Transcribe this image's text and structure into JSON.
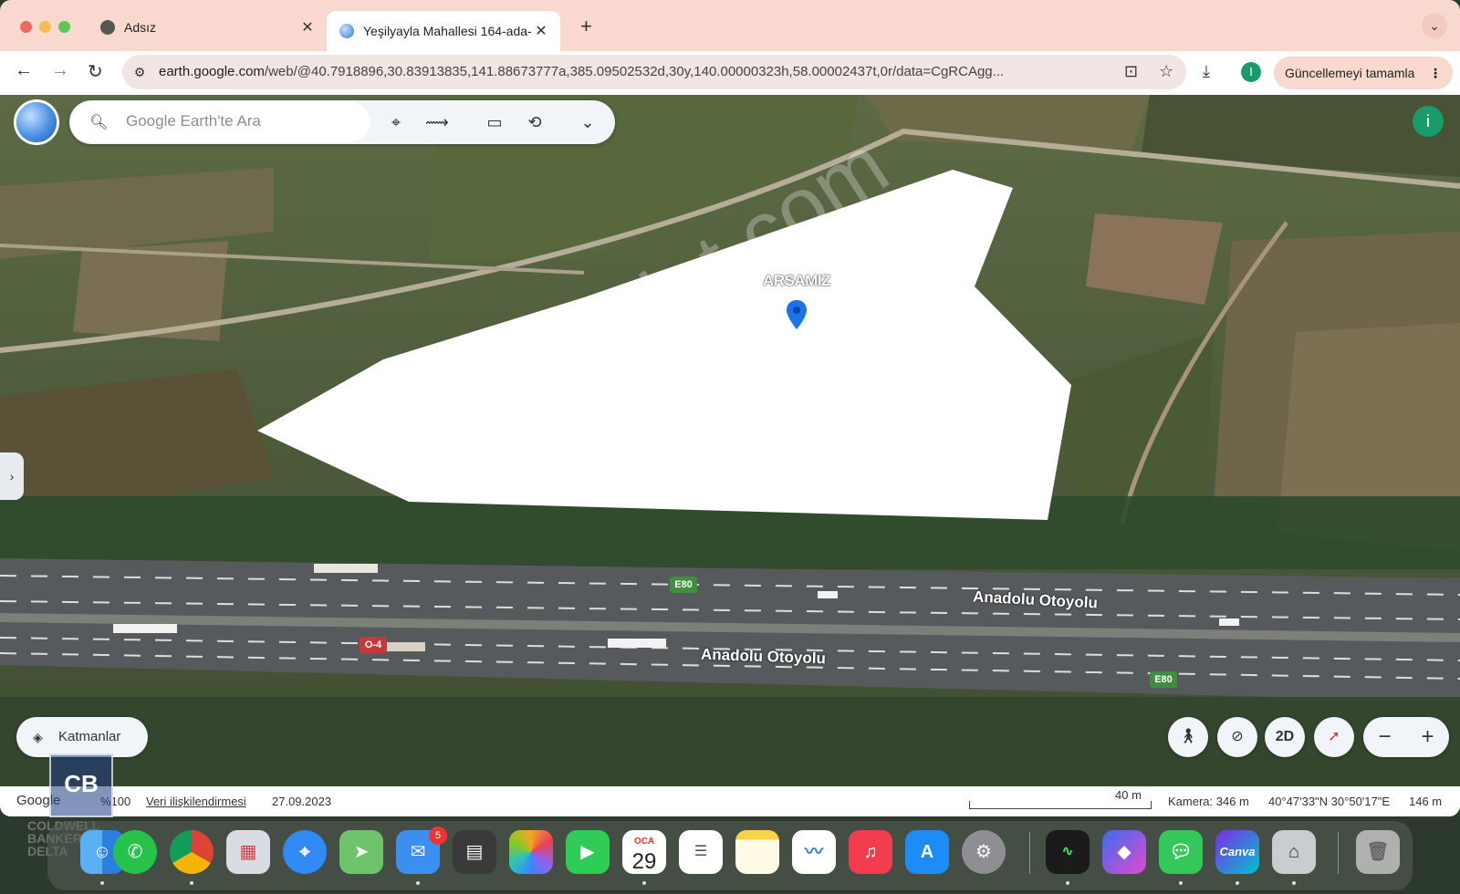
{
  "browser": {
    "tabs": [
      {
        "title": "Adsız"
      },
      {
        "title": "Yeşilyayla Mahallesi 164-ada-"
      }
    ],
    "url_host": "earth.google.com",
    "url_path": "/web/@40.7918896,30.83913835,141.88673777a,385.09502532d,30y,140.00000323h,58.00002437t,0r/data=CgRCAgg...",
    "update_label": "Güncellemeyi tamamla",
    "profile_initial": "I"
  },
  "earth": {
    "search_placeholder": "Google Earth'te Ara",
    "user_initial": "i",
    "parcel_label": "ARSAMIZ",
    "road_labels": [
      "Anadolu Otoyolu",
      "Anadolu Otoyolu"
    ],
    "shields": [
      {
        "text": "E80",
        "color": "#3f8f3f"
      },
      {
        "text": "E80",
        "color": "#3f8f3f"
      },
      {
        "text": "O-4",
        "color": "#c43a3a"
      }
    ],
    "watermark": "emlakjet.com",
    "layers_label": "Katmanlar",
    "ctrl_2d": "2D"
  },
  "status": {
    "google": "Google",
    "zoom": "%100",
    "data_link": "Veri ilişkilendirmesi",
    "date": "27.09.2023",
    "scale": "40 m",
    "camera": "Kamera: 346 m",
    "coords": "40°47'33\"N 30°50'17\"E",
    "elevation": "146 m"
  },
  "branding": {
    "logo_text": "CB",
    "company": [
      "COLDWELL",
      "BANKER",
      "DELTA"
    ]
  },
  "dock": {
    "calendar_month": "OCA",
    "calendar_day": "29",
    "mail_badge": "5",
    "canva_label": "Canva",
    "apps": [
      "finder",
      "whatsapp",
      "chrome",
      "launchpad",
      "safari",
      "maps",
      "mail",
      "calculator",
      "photos",
      "facetime",
      "calendar",
      "reminders",
      "notes",
      "freeform",
      "music",
      "appstore",
      "settings",
      "activity-monitor",
      "shortcuts",
      "messages",
      "canva",
      "ai-app",
      "trash"
    ]
  }
}
